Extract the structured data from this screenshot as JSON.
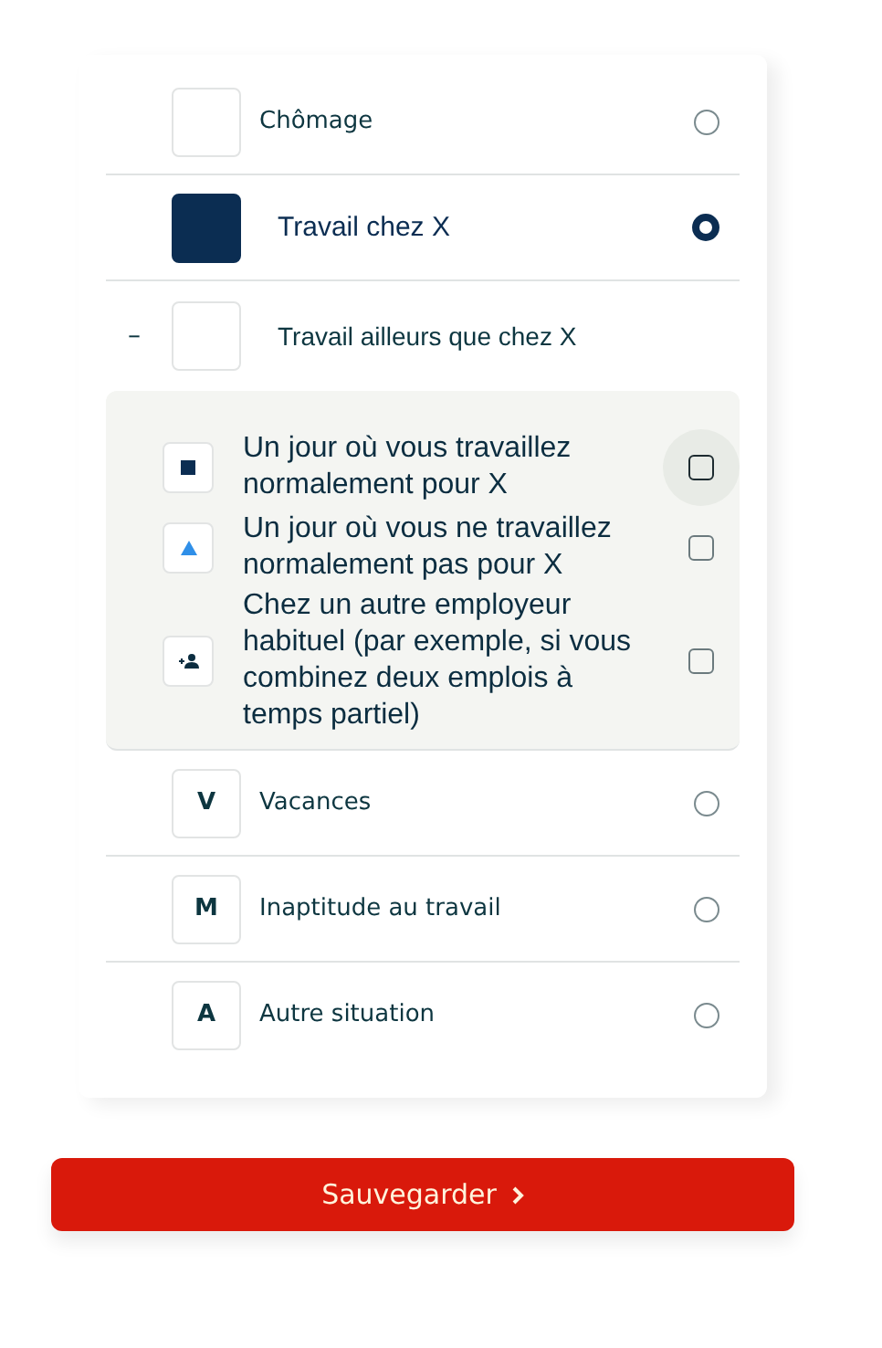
{
  "options": [
    {
      "kind": "radio",
      "label": "Chômage",
      "selected": false
    },
    {
      "kind": "radio",
      "label": "Travail chez  X",
      "selected": true
    },
    {
      "kind": "group",
      "label": "Travail ailleurs que chez X",
      "toggle": "–",
      "expanded": true,
      "children": [
        {
          "label": "Un jour où vous travaillez normalement pour X",
          "checked": false,
          "hovered": true
        },
        {
          "label": "Un jour où vous ne travaillez normalement pas pour X",
          "checked": false,
          "hovered": false
        },
        {
          "label": "Chez un autre employeur habituel (par exemple, si vous combinez deux emplois à temps partiel)",
          "checked": false,
          "hovered": false
        }
      ]
    },
    {
      "kind": "radio",
      "label": "Vacances",
      "letter": "V",
      "selected": false
    },
    {
      "kind": "radio",
      "label": "Inaptitude au travail",
      "letter": "M",
      "selected": false
    },
    {
      "kind": "radio",
      "label": "Autre situation",
      "letter": "A",
      "selected": false
    }
  ],
  "save_button": "Sauvegarder"
}
